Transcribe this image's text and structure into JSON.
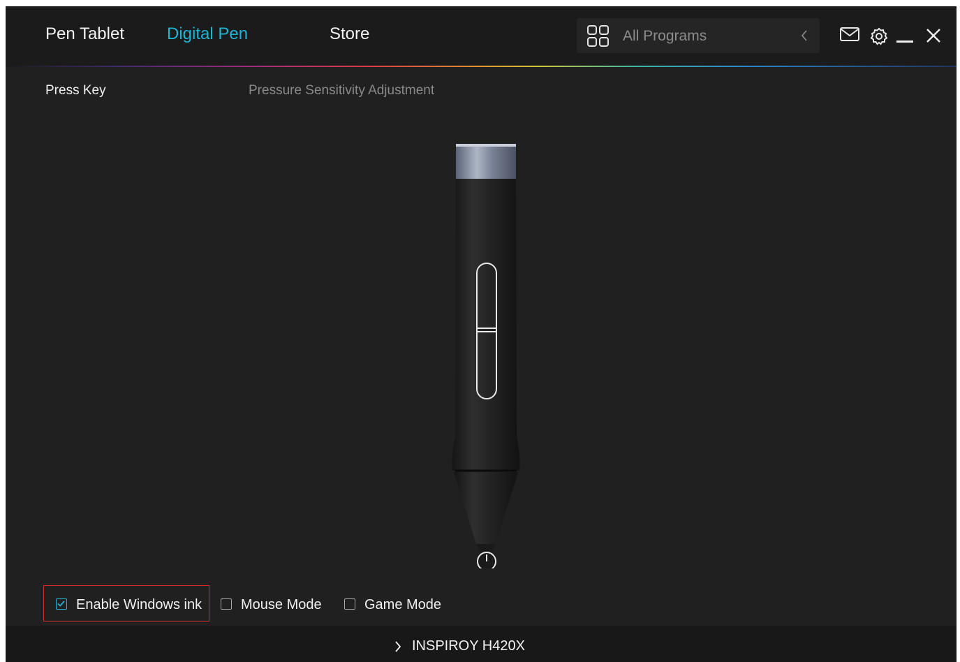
{
  "nav": {
    "tabs": [
      {
        "label": "Pen Tablet",
        "active": false
      },
      {
        "label": "Digital Pen",
        "active": true
      },
      {
        "label": "Store",
        "active": false
      }
    ],
    "program_select": {
      "label": "All Programs",
      "icon": "grid-icon"
    },
    "window_controls": [
      "mail-icon",
      "gear-icon",
      "minimize-icon",
      "close-icon"
    ]
  },
  "subtabs": {
    "press_key": "Press Key",
    "pressure": "Pressure Sensitivity Adjustment"
  },
  "options": [
    {
      "label": "Enable Windows ink",
      "checked": true
    },
    {
      "label": "Mouse Mode",
      "checked": false
    },
    {
      "label": "Game Mode",
      "checked": false
    }
  ],
  "footer": {
    "device_name": "INSPIROY H420X"
  },
  "colors": {
    "accent": "#1fb3d3",
    "highlight": "#d62b2b",
    "background": "#202020"
  }
}
